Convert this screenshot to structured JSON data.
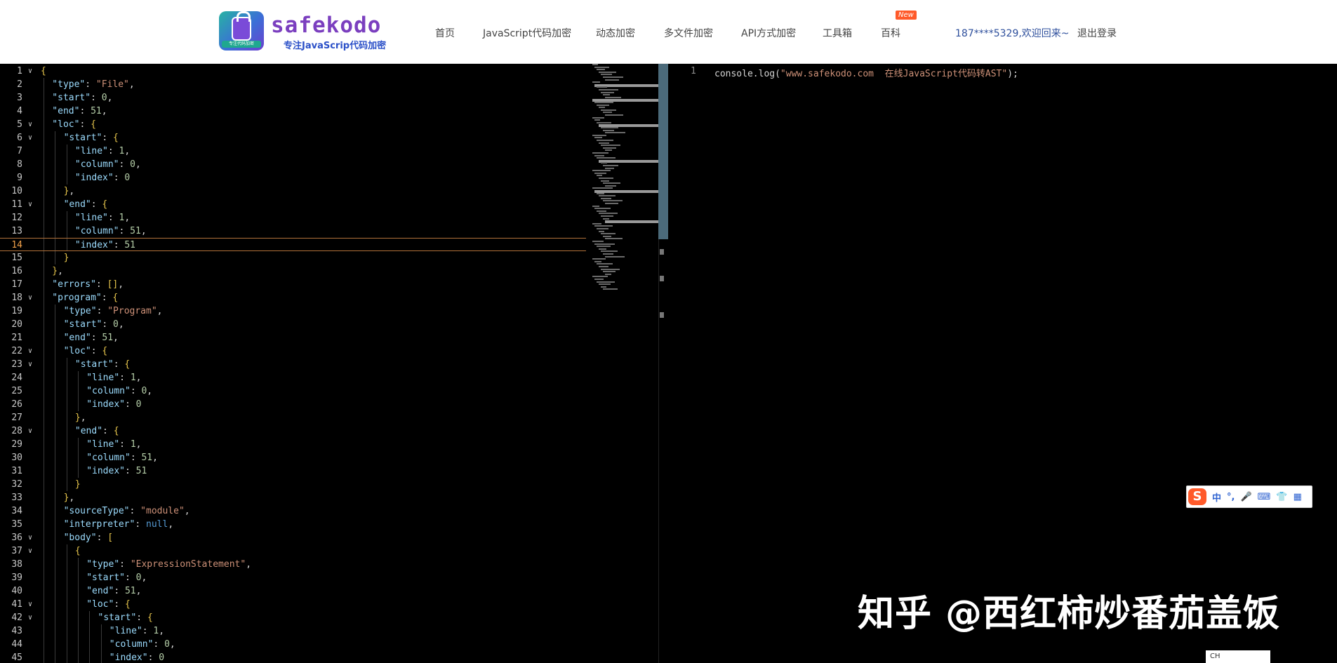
{
  "brand": {
    "name": "safekodo",
    "tagline": "专注JavaScrip代码加密",
    "badge_text": "专注代码加密",
    "colors": {
      "title": "#7b3fbf",
      "tagline": "#2b50c8",
      "badge": "#1fa88f"
    }
  },
  "nav": {
    "items": [
      {
        "label": "首页"
      },
      {
        "label": "JavaScript代码加密"
      },
      {
        "label": "动态加密"
      },
      {
        "label": "多文件加密"
      },
      {
        "label": "API方式加密"
      },
      {
        "label": "工具箱"
      },
      {
        "label": "百科"
      }
    ],
    "new_badge": "New",
    "user": "187****5329,欢迎回来~",
    "logout": "退出登录"
  },
  "left_editor": {
    "current_line": 14,
    "lines": [
      {
        "n": 1,
        "fold": true,
        "indent": 0,
        "t": "{"
      },
      {
        "n": 2,
        "indent": 1,
        "t": "\"type\": \"File\","
      },
      {
        "n": 3,
        "indent": 1,
        "t": "\"start\": 0,"
      },
      {
        "n": 4,
        "indent": 1,
        "t": "\"end\": 51,"
      },
      {
        "n": 5,
        "fold": true,
        "indent": 1,
        "t": "\"loc\": {"
      },
      {
        "n": 6,
        "fold": true,
        "indent": 2,
        "t": "\"start\": {"
      },
      {
        "n": 7,
        "indent": 3,
        "t": "\"line\": 1,"
      },
      {
        "n": 8,
        "indent": 3,
        "t": "\"column\": 0,"
      },
      {
        "n": 9,
        "indent": 3,
        "t": "\"index\": 0"
      },
      {
        "n": 10,
        "indent": 2,
        "t": "},"
      },
      {
        "n": 11,
        "fold": true,
        "indent": 2,
        "t": "\"end\": {"
      },
      {
        "n": 12,
        "indent": 3,
        "t": "\"line\": 1,"
      },
      {
        "n": 13,
        "indent": 3,
        "t": "\"column\": 51,"
      },
      {
        "n": 14,
        "indent": 3,
        "t": "\"index\": 51"
      },
      {
        "n": 15,
        "indent": 2,
        "t": "}"
      },
      {
        "n": 16,
        "indent": 1,
        "t": "},"
      },
      {
        "n": 17,
        "indent": 1,
        "t": "\"errors\": [],"
      },
      {
        "n": 18,
        "fold": true,
        "indent": 1,
        "t": "\"program\": {"
      },
      {
        "n": 19,
        "indent": 2,
        "t": "\"type\": \"Program\","
      },
      {
        "n": 20,
        "indent": 2,
        "t": "\"start\": 0,"
      },
      {
        "n": 21,
        "indent": 2,
        "t": "\"end\": 51,"
      },
      {
        "n": 22,
        "fold": true,
        "indent": 2,
        "t": "\"loc\": {"
      },
      {
        "n": 23,
        "fold": true,
        "indent": 3,
        "t": "\"start\": {"
      },
      {
        "n": 24,
        "indent": 4,
        "t": "\"line\": 1,"
      },
      {
        "n": 25,
        "indent": 4,
        "t": "\"column\": 0,"
      },
      {
        "n": 26,
        "indent": 4,
        "t": "\"index\": 0"
      },
      {
        "n": 27,
        "indent": 3,
        "t": "},"
      },
      {
        "n": 28,
        "fold": true,
        "indent": 3,
        "t": "\"end\": {"
      },
      {
        "n": 29,
        "indent": 4,
        "t": "\"line\": 1,"
      },
      {
        "n": 30,
        "indent": 4,
        "t": "\"column\": 51,"
      },
      {
        "n": 31,
        "indent": 4,
        "t": "\"index\": 51"
      },
      {
        "n": 32,
        "indent": 3,
        "t": "}"
      },
      {
        "n": 33,
        "indent": 2,
        "t": "},"
      },
      {
        "n": 34,
        "indent": 2,
        "t": "\"sourceType\": \"module\","
      },
      {
        "n": 35,
        "indent": 2,
        "t": "\"interpreter\": null,"
      },
      {
        "n": 36,
        "fold": true,
        "indent": 2,
        "t": "\"body\": ["
      },
      {
        "n": 37,
        "fold": true,
        "indent": 3,
        "t": "{"
      },
      {
        "n": 38,
        "indent": 4,
        "t": "\"type\": \"ExpressionStatement\","
      },
      {
        "n": 39,
        "indent": 4,
        "t": "\"start\": 0,"
      },
      {
        "n": 40,
        "indent": 4,
        "t": "\"end\": 51,"
      },
      {
        "n": 41,
        "fold": true,
        "indent": 4,
        "t": "\"loc\": {"
      },
      {
        "n": 42,
        "fold": true,
        "indent": 5,
        "t": "\"start\": {"
      },
      {
        "n": 43,
        "indent": 6,
        "t": "\"line\": 1,"
      },
      {
        "n": 44,
        "indent": 6,
        "t": "\"column\": 0,"
      },
      {
        "n": 45,
        "indent": 6,
        "t": "\"index\": 0"
      }
    ]
  },
  "right_editor": {
    "line_number": "1",
    "code": "console.log(\"www.safekodo.com  在线JavaScript代码转AST\");"
  },
  "ime": {
    "logo": "S",
    "icons": [
      "中",
      "°,",
      "mic-icon",
      "keyboard-icon",
      "shirt-icon",
      "grid-icon"
    ],
    "mini_label": "CH"
  },
  "watermark": "知乎 @西红柿炒番茄盖饭"
}
